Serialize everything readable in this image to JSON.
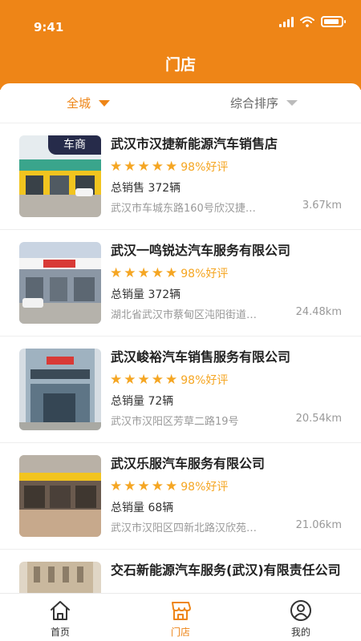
{
  "status": {
    "time": "9:41"
  },
  "header": {
    "title": "门店"
  },
  "filters": {
    "city": "全城",
    "sort": "综合排序"
  },
  "stores": [
    {
      "name": "武汉市汉捷新能源汽车销售店",
      "rating": "98%好评",
      "stars": 5,
      "sales": "总销售 372辆",
      "address": "武汉市车城东路160号欣汉捷…",
      "distance": "3.67km",
      "tag": "车商"
    },
    {
      "name": "武汉一鸣锐达汽车服务有限公司",
      "rating": "98%好评",
      "stars": 5,
      "sales": "总销量 372辆",
      "address": "湖北省武汉市蔡甸区沌阳街道…",
      "distance": "24.48km"
    },
    {
      "name": "武汉峻裕汽车销售服务有限公司",
      "rating": "98%好评",
      "stars": 5,
      "sales": "总销量 72辆",
      "address": "武汉市汉阳区芳草二路19号",
      "distance": "20.54km"
    },
    {
      "name": "武汉乐服汽车服务有限公司",
      "rating": "98%好评",
      "stars": 5,
      "sales": "总销量 68辆",
      "address": "武汉市汉阳区四新北路汉欣苑…",
      "distance": "21.06km"
    },
    {
      "name": "交石新能源汽车服务(武汉)有限责任公司"
    }
  ],
  "tabbar": [
    {
      "label": "首页",
      "icon": "home-icon"
    },
    {
      "label": "门店",
      "icon": "store-icon",
      "active": true
    },
    {
      "label": "我的",
      "icon": "profile-icon"
    }
  ],
  "colors": {
    "accent": "#ee8517",
    "star": "#f5a623",
    "tag_bg": "#262b4a"
  }
}
